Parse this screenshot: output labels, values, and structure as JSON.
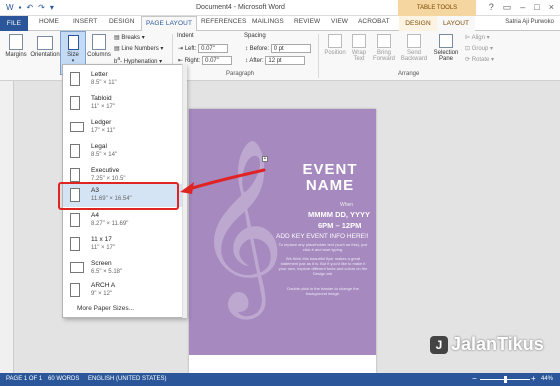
{
  "window": {
    "title": "Document4 - Microsoft Word",
    "context_tab_header": "TABLE TOOLS",
    "user": "Satria Aji Purwoko"
  },
  "tabs": {
    "file": "FILE",
    "home": "HOME",
    "insert": "INSERT",
    "design": "DESIGN",
    "page_layout": "PAGE LAYOUT",
    "references": "REFERENCES",
    "mailings": "MAILINGS",
    "review": "REVIEW",
    "view": "VIEW",
    "acrobat": "ACROBAT",
    "ctx_design": "DESIGN",
    "ctx_layout": "LAYOUT"
  },
  "ribbon": {
    "margins": "Margins",
    "orientation": "Orientation",
    "size": "Size",
    "columns": "Columns",
    "breaks": "Breaks",
    "line_numbers": "Line Numbers",
    "hyphenation": "Hyphenation",
    "indent_label": "Indent",
    "left_label": "Left:",
    "left_value": "0.07\"",
    "right_label": "Right:",
    "right_value": "0.07\"",
    "spacing_label": "Spacing",
    "before_label": "Before:",
    "before_value": "0 pt",
    "after_label": "After:",
    "after_value": "12 pt",
    "paragraph_group": "Paragraph",
    "arrange_group": "Arrange",
    "position": "Position",
    "wrap_text": "Wrap Text",
    "bring_forward": "Bring Forward",
    "send_backward": "Send Backward",
    "selection_pane": "Selection Pane",
    "align": "Align",
    "group": "Group",
    "rotate": "Rotate"
  },
  "size_menu": {
    "items": [
      {
        "name": "Letter",
        "dims": "8.5\" × 11\""
      },
      {
        "name": "Tabloid",
        "dims": "11\" × 17\""
      },
      {
        "name": "Ledger",
        "dims": "17\" × 11\""
      },
      {
        "name": "Legal",
        "dims": "8.5\" × 14\""
      },
      {
        "name": "Executive",
        "dims": "7.25\" × 10.5\""
      },
      {
        "name": "A3",
        "dims": "11.69\" × 16.54\""
      },
      {
        "name": "A4",
        "dims": "8.27\" × 11.69\""
      },
      {
        "name": "11 x 17",
        "dims": "11\" × 17\""
      },
      {
        "name": "Screen",
        "dims": "6.5\" × 5.18\""
      },
      {
        "name": "ARCH A",
        "dims": "9\" × 12\""
      }
    ],
    "more": "More Paper Sizes...",
    "highlighted": "A3"
  },
  "flyer": {
    "title_line1": "EVENT",
    "title_line2": "NAME",
    "when": "When",
    "date": "MMMM DD, YYYY",
    "time": "6PM – 12PM",
    "key_info": "ADD KEY EVENT INFO HERE!!",
    "body1": "To replace any placeholder text (such as this), just click it and start typing.",
    "body2": "We think this beautiful flyer makes a great statement just as it is. But if you'd like to make it your own, explore different fonts and colors on the Design tab.",
    "body3": "Double-click in the header to change the background image."
  },
  "statusbar": {
    "page": "PAGE 1 OF 1",
    "words": "60 WORDS",
    "language": "ENGLISH (UNITED STATES)",
    "zoom": "44%"
  },
  "watermark": {
    "text": "JalanTikus"
  },
  "colors": {
    "word_blue": "#2b579a",
    "flyer_purple": "#a589bf",
    "highlight_red": "#e02424"
  }
}
